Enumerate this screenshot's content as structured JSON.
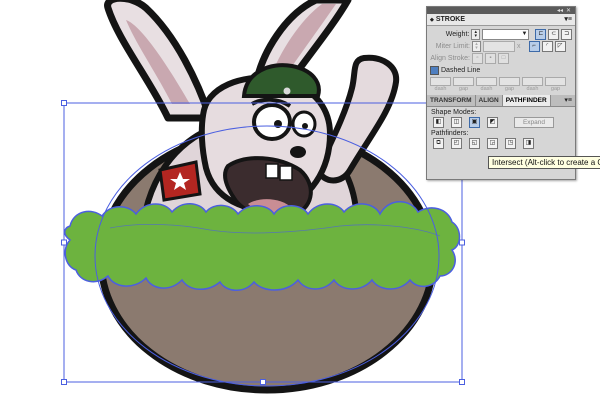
{
  "colors": {
    "selection": "#4b5fe0",
    "green": "#6db33f",
    "brown": "#8b7a6f",
    "hat": "#2f5a2c"
  },
  "stroke_panel": {
    "title": "STROKE",
    "weight_label": "Weight:",
    "miter_label": "Miter Limit:",
    "miter_suffix": "x",
    "align_label": "Align Stroke:",
    "dashed_label": "Dashed Line",
    "dash_labels": [
      "dash",
      "gap",
      "dash",
      "gap",
      "dash",
      "gap"
    ]
  },
  "tabs_panel": {
    "tabs": [
      "TRANSFORM",
      "ALIGN",
      "PATHFINDER"
    ],
    "shape_modes_label": "Shape Modes:",
    "expand_label": "Expand",
    "pathfinders_label": "Pathfinders:"
  },
  "tooltip": "Intersect (Alt-click to create a C"
}
